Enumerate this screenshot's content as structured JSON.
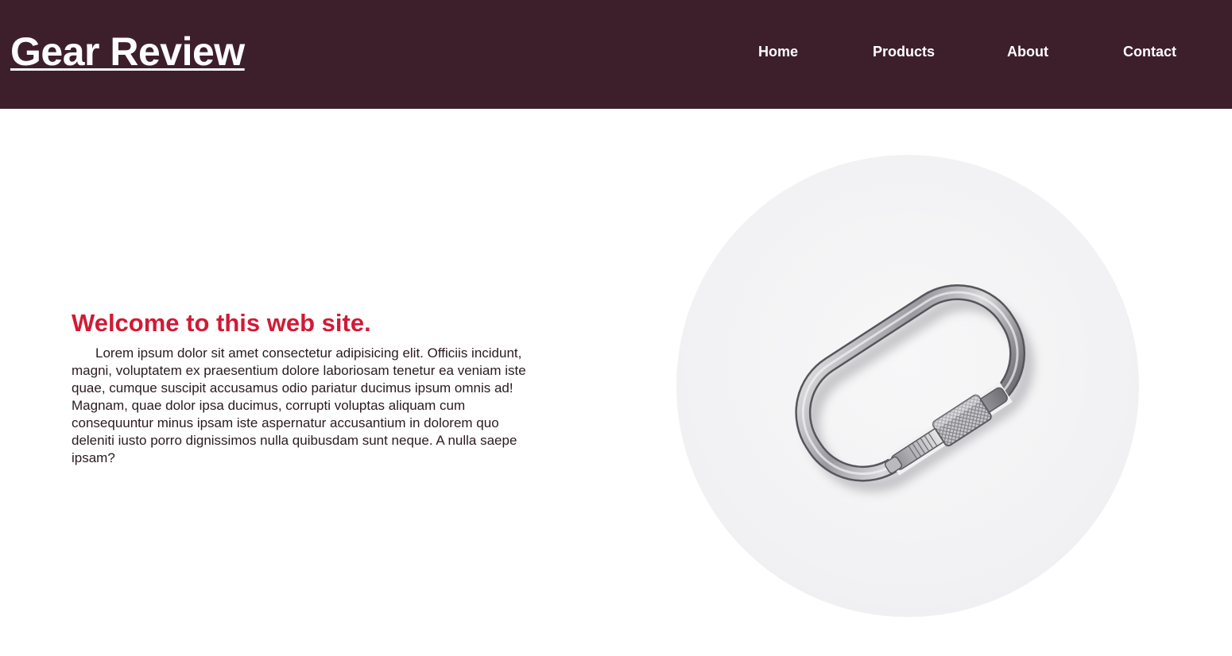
{
  "header": {
    "logo": "Gear Review",
    "nav": {
      "home": "Home",
      "products": "Products",
      "about": "About",
      "contact": "Contact"
    }
  },
  "main": {
    "heading": "Welcome to this web site.",
    "body": "Lorem ipsum dolor sit amet consectetur adipisicing elit. Officiis incidunt, magni, voluptatem ex praesentium dolore laboriosam tenetur ea veniam iste quae, cumque suscipit accusamus odio pariatur ducimus ipsum omnis ad! Magnam, quae dolor ipsa ducimus, corrupti voluptas aliquam cum consequuntur minus ipsam iste aspernatur accusantium in dolorem quo deleniti iusto porro dignissimos nulla quibusdam sunt neque. A nulla saepe ipsam?",
    "hero_image": "carabiner-photo"
  },
  "colors": {
    "header_bg": "#3d1f2b",
    "heading": "#d11a36",
    "text": "#2a1a1f"
  }
}
